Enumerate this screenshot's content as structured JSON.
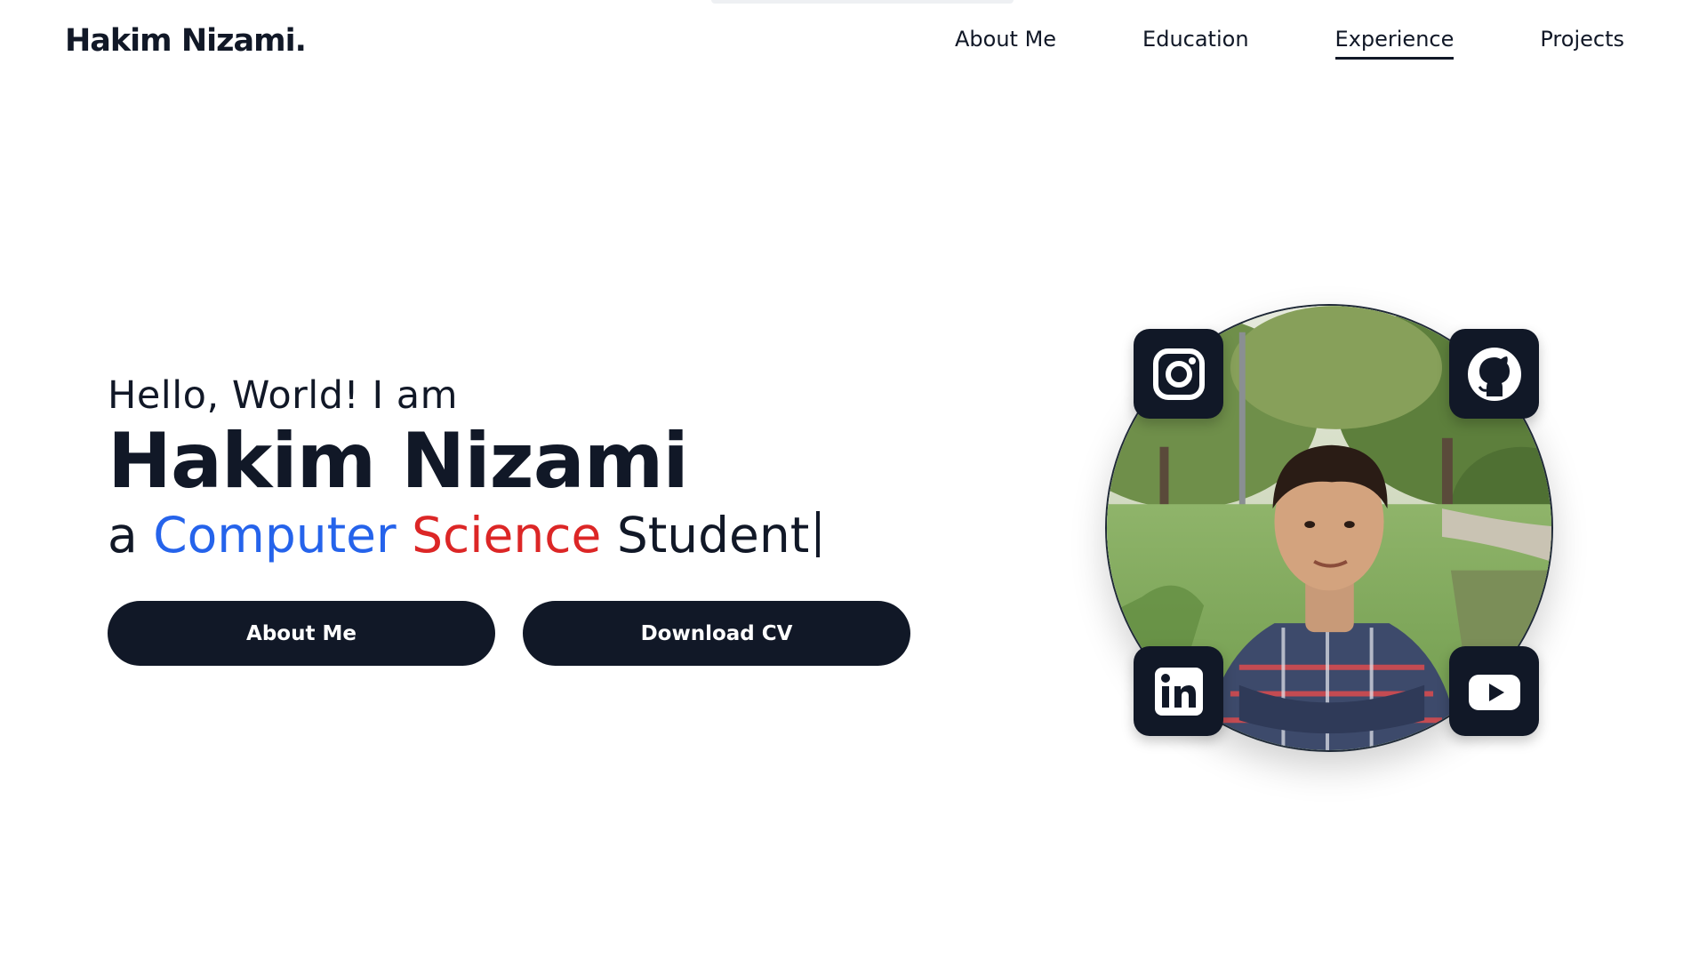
{
  "header": {
    "logo": "Hakim Nizami.",
    "nav": [
      {
        "label": "About Me",
        "active": false
      },
      {
        "label": "Education",
        "active": false
      },
      {
        "label": "Experience",
        "active": true
      },
      {
        "label": "Projects",
        "active": false
      }
    ]
  },
  "hero": {
    "greeting": "Hello, World! I am",
    "name": "Hakim Nizami",
    "role_prefix": "a",
    "role_word_1": "Computer",
    "role_word_2": "Science",
    "role_word_3": "Student",
    "buttons": {
      "about": "About Me",
      "download": "Download CV"
    }
  },
  "profile": {
    "photo_icon": "profile-photo",
    "socials": [
      {
        "name": "instagram",
        "icon": "instagram-icon"
      },
      {
        "name": "github",
        "icon": "github-icon"
      },
      {
        "name": "linkedin",
        "icon": "linkedin-icon"
      },
      {
        "name": "youtube",
        "icon": "youtube-icon"
      }
    ]
  },
  "colors": {
    "dark": "#111827",
    "blue": "#2563eb",
    "red": "#dc2626",
    "background": "#ffffff"
  }
}
